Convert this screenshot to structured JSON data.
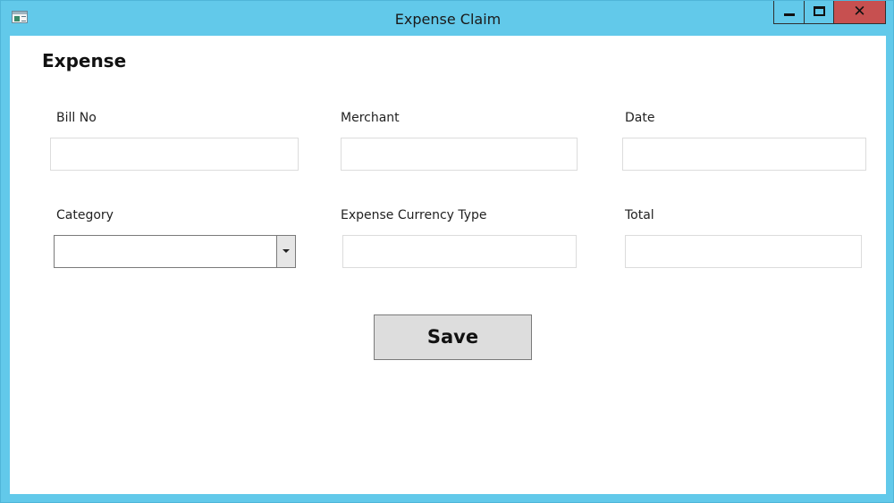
{
  "window": {
    "title": "Expense Claim",
    "close_glyph": "✕",
    "icon": "app-window-icon"
  },
  "form": {
    "heading": "Expense",
    "fields": {
      "bill_no": {
        "label": "Bill No",
        "value": ""
      },
      "merchant": {
        "label": "Merchant",
        "value": ""
      },
      "date": {
        "label": "Date",
        "value": ""
      },
      "category": {
        "label": "Category",
        "value": ""
      },
      "currency_type": {
        "label": "Expense Currency Type",
        "value": ""
      },
      "total": {
        "label": "Total",
        "value": ""
      }
    },
    "save_label": "Save"
  },
  "colors": {
    "titlebar": "#62c9ea",
    "close_button": "#c75050",
    "button_face": "#dddddd"
  }
}
